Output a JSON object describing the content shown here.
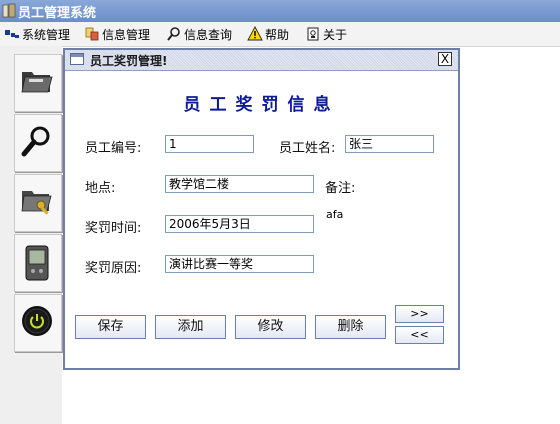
{
  "app": {
    "title": "员工管理系统"
  },
  "menu": [
    {
      "label": "系统管理",
      "icon": "system-icon"
    },
    {
      "label": "信息管理",
      "icon": "info-icon"
    },
    {
      "label": "信息查询",
      "icon": "search-icon"
    },
    {
      "label": "帮助",
      "icon": "warning-icon"
    },
    {
      "label": "关于",
      "icon": "about-icon"
    }
  ],
  "toolbar": [
    {
      "icon": "folder-icon"
    },
    {
      "icon": "magnifier-icon"
    },
    {
      "icon": "keys-folder-icon"
    },
    {
      "icon": "handheld-icon"
    },
    {
      "icon": "power-icon"
    }
  ],
  "dialog": {
    "title": "员工奖罚管理!",
    "close": "X",
    "heading": "员工奖罚信息",
    "labels": {
      "emp_no": "员工编号:",
      "emp_name": "员工姓名:",
      "place": "地点:",
      "remarks": "备注:",
      "time": "奖罚时间:",
      "reason": "奖罚原因:"
    },
    "values": {
      "emp_no": "1",
      "emp_name": "张三",
      "place": "教学馆二楼",
      "time": "2006年5月3日",
      "reason": "演讲比赛一等奖",
      "remarks": "afa"
    },
    "buttons": {
      "save": "保存",
      "add": "添加",
      "edit": "修改",
      "delete": "删除",
      "next": ">>",
      "prev": "<<"
    }
  },
  "colors": {
    "titlebar": "#6b8cc8",
    "heading": "#0c1a9a",
    "frame_border": "#6e7fa5"
  }
}
